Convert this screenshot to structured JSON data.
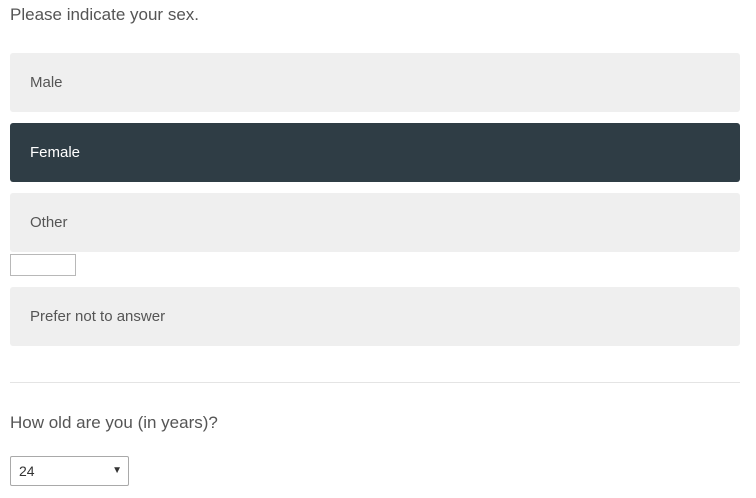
{
  "sex_question": {
    "prompt": "Please indicate your sex.",
    "options": [
      {
        "label": "Male",
        "selected": false
      },
      {
        "label": "Female",
        "selected": true
      },
      {
        "label": "Other",
        "selected": false
      },
      {
        "label": "Prefer not to answer",
        "selected": false
      }
    ],
    "other_text_value": ""
  },
  "age_question": {
    "prompt": "How old are you (in years)?",
    "selected_value": "24",
    "arrow_icon": "triangle-down-icon"
  },
  "colors": {
    "selected_background": "#2f3d45",
    "option_background": "#efefef",
    "text": "#555555"
  }
}
